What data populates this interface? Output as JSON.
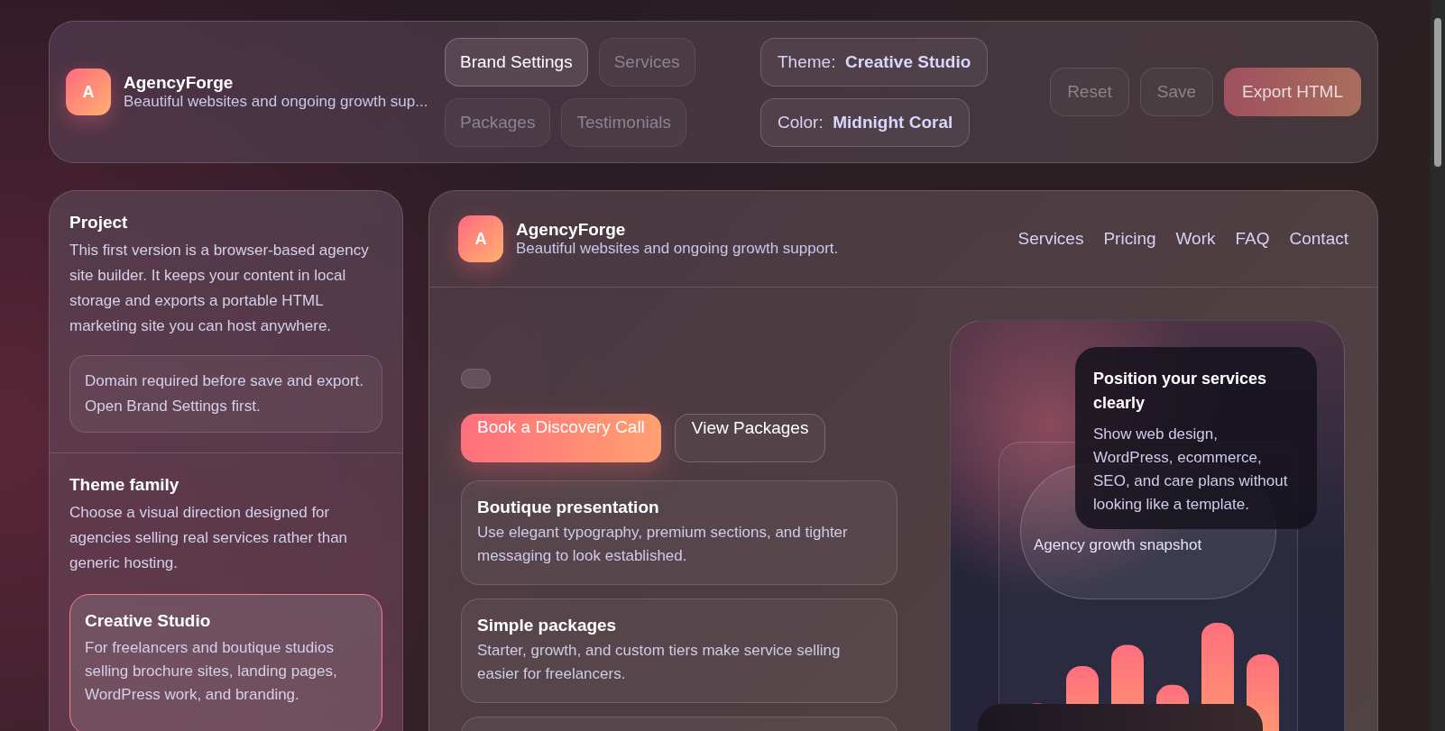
{
  "topbar": {
    "brand": {
      "initial": "A",
      "name": "AgencyForge",
      "tagline": "Beautiful websites and ongoing growth sup..."
    },
    "tabs": [
      {
        "label": "Brand Settings",
        "selected": true
      },
      {
        "label": "Services",
        "selected": false
      },
      {
        "label": "Packages",
        "selected": false
      },
      {
        "label": "Testimonials",
        "selected": false
      }
    ],
    "pickers": [
      {
        "label": "Theme:",
        "value": "Creative Studio"
      },
      {
        "label": "Color:",
        "value": "Midnight Coral"
      }
    ],
    "actions": [
      {
        "label": "Reset",
        "kind": "ghost",
        "disabled": true
      },
      {
        "label": "Save",
        "kind": "ghost",
        "disabled": true
      },
      {
        "label": "Export HTML",
        "kind": "primary",
        "disabled": true
      }
    ]
  },
  "sidebar": {
    "project": {
      "title": "Project",
      "text": "This first version is a browser-based agency site builder. It keeps your content in local storage and exports a portable HTML marketing site you can host anywhere.",
      "notice": "Domain required before save and export. Open Brand Settings first."
    },
    "theme_family": {
      "title": "Theme family",
      "text": "Choose a visual direction designed for agencies selling real services rather than generic hosting.",
      "options": [
        {
          "name": "Creative Studio",
          "text": "For freelancers and boutique studios selling brochure sites, landing pages, WordPress work, and branding.",
          "selected": true
        }
      ]
    }
  },
  "preview": {
    "brand": {
      "initial": "A",
      "name": "AgencyForge",
      "tagline": "Beautiful websites and ongoing growth support."
    },
    "nav": [
      "Services",
      "Pricing",
      "Work",
      "FAQ",
      "Contact"
    ],
    "hero_buttons": [
      {
        "label": "Book a Discovery Call",
        "kind": "primary"
      },
      {
        "label": "View Packages",
        "kind": "secondary"
      }
    ],
    "features": [
      {
        "title": "Boutique presentation",
        "text": "Use elegant typography, premium sections, and tighter messaging to look established."
      },
      {
        "title": "Simple packages",
        "text": "Starter, growth, and custom tiers make service selling easier for freelancers."
      }
    ],
    "visual": {
      "card_title": "Position your services clearly",
      "card_text": "Show web design, WordPress, ecommerce, SEO, and care plans without looking like a template.",
      "snapshot_label": "Agency growth snapshot"
    }
  }
}
